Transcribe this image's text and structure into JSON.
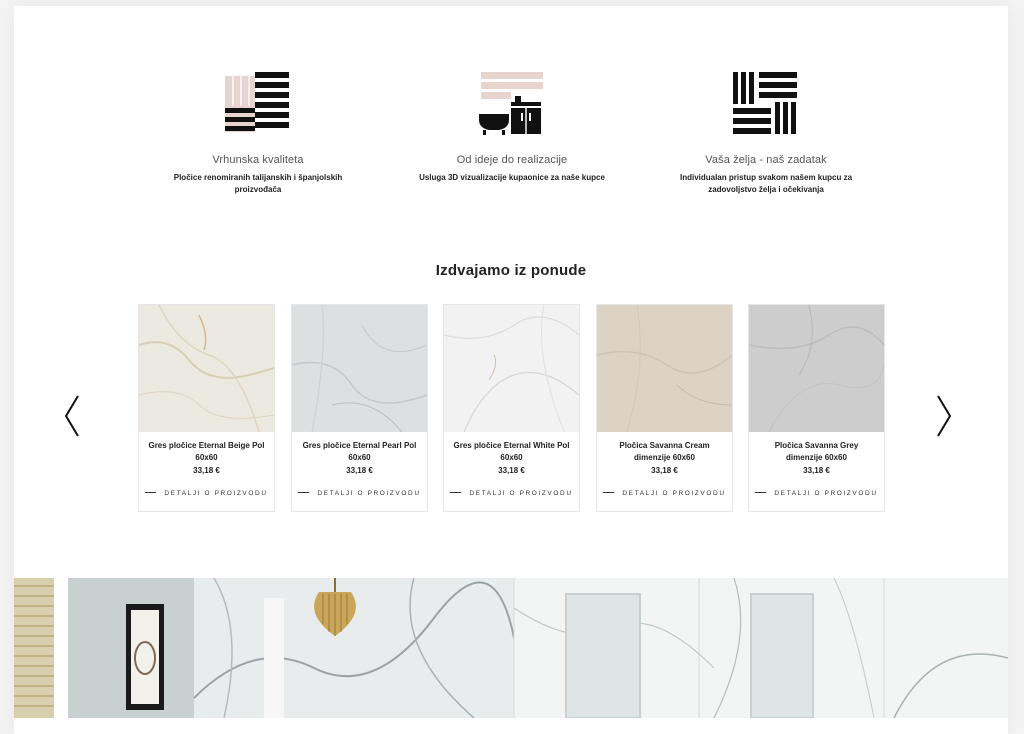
{
  "features": [
    {
      "icon": "tiles-stack-icon",
      "title": "Vrhunska kvaliteta",
      "description": "Pločice renomiranih talijanskih i španjolskih proizvođača"
    },
    {
      "icon": "bathroom-vanity-icon",
      "title": "Od ideje do realizacije",
      "description": "Usluga 3D vizualizacije kupaonice za naše kupce"
    },
    {
      "icon": "parquet-pattern-icon",
      "title": "Vaša želja - naš zadatak",
      "description": "Individualan pristup svakom našem kupcu za zadovoljstvo želja i očekivanja"
    }
  ],
  "featured": {
    "title": "Izdvajamo iz ponude",
    "prev_icon": "chevron-left-icon",
    "next_icon": "chevron-right-icon",
    "products": [
      {
        "name": "Gres pločice Eternal Beige Pol 60x60",
        "price": "33,18 €",
        "details_label": "DETALJI O PROIZVODU",
        "color": "#ece9e0"
      },
      {
        "name": "Gres pločice Eternal Pearl Pol 60x60",
        "price": "33,18 €",
        "details_label": "DETALJI O PROIZVODU",
        "color": "#dedfe0"
      },
      {
        "name": "Gres pločice Eternal White Pol 60x60",
        "price": "33,18 €",
        "details_label": "DETALJI O PROIZVODU",
        "color": "#f1f2f1"
      },
      {
        "name": "Pločica Savanna Cream dimenzije 60x60",
        "price": "33,18 €",
        "details_label": "DETALJI O PROIZVODU",
        "color": "#ddd3c5"
      },
      {
        "name": "Pločica Savanna Grey dimenzije 60x60",
        "price": "33,18 €",
        "details_label": "DETALJI O PROIZVODU",
        "color": "#cdcdcd"
      }
    ]
  },
  "colors": {
    "accent_pink": "#e8d4cf",
    "icon_dark": "#111111"
  }
}
